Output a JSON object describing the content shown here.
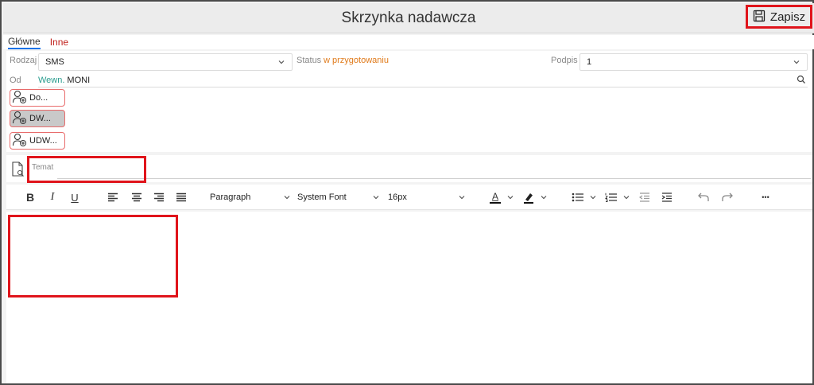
{
  "window": {
    "title": "Skrzynka nadawcza"
  },
  "toolbar_top": {
    "save_label": "Zapisz"
  },
  "tabs": [
    {
      "label": "Główne",
      "active": true
    },
    {
      "label": "Inne",
      "active": false
    }
  ],
  "form": {
    "rodzaj": {
      "label": "Rodzaj",
      "value": "SMS"
    },
    "status": {
      "label": "Status",
      "value": "w przygotowaniu"
    },
    "podpis": {
      "label": "Podpis",
      "value": "1"
    },
    "od": {
      "label": "Od",
      "value_prefix": "Wewn.",
      "value": "MONI"
    }
  },
  "recipients": [
    {
      "label": "Do...",
      "selected": false
    },
    {
      "label": "DW...",
      "selected": true
    },
    {
      "label": "UDW...",
      "selected": false
    }
  ],
  "subject": {
    "label": "Temat",
    "value": ""
  },
  "editor_toolbar": {
    "bold": "B",
    "italic": "I",
    "underline": "U",
    "paragraph": "Paragraph",
    "font": "System Font",
    "size": "16px",
    "text_color_letter": "A",
    "more": "•••"
  },
  "colors": {
    "highlight_box": "#e0141b",
    "status_text": "#e07a1a",
    "tab_inne": "#c0201b",
    "od_prefix": "#2a9d8f"
  }
}
